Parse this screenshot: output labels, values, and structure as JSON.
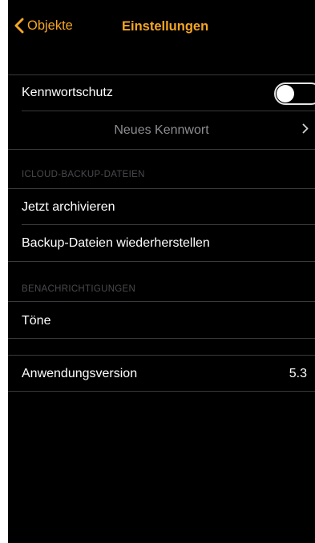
{
  "nav": {
    "back_label": "Objekte",
    "title": "Einstellungen"
  },
  "security": {
    "password_protection_label": "Kennwortschutz",
    "password_protection_on": false,
    "new_password_label": "Neues Kennwort"
  },
  "backup": {
    "header": "ICLOUD-BACKUP-DATEIEN",
    "archive_now_label": "Jetzt archivieren",
    "restore_label": "Backup-Dateien wiederherstellen"
  },
  "notifications": {
    "header": "BENACHRICHTIGUNGEN",
    "sounds_label": "Töne"
  },
  "about": {
    "version_label": "Anwendungsversion",
    "version_value": "5.3"
  },
  "colors": {
    "accent": "#f5a623",
    "background": "#000000",
    "cell": "#1c1c1e",
    "separator": "#3a3a3c",
    "section_header": "#4a4a4e"
  }
}
